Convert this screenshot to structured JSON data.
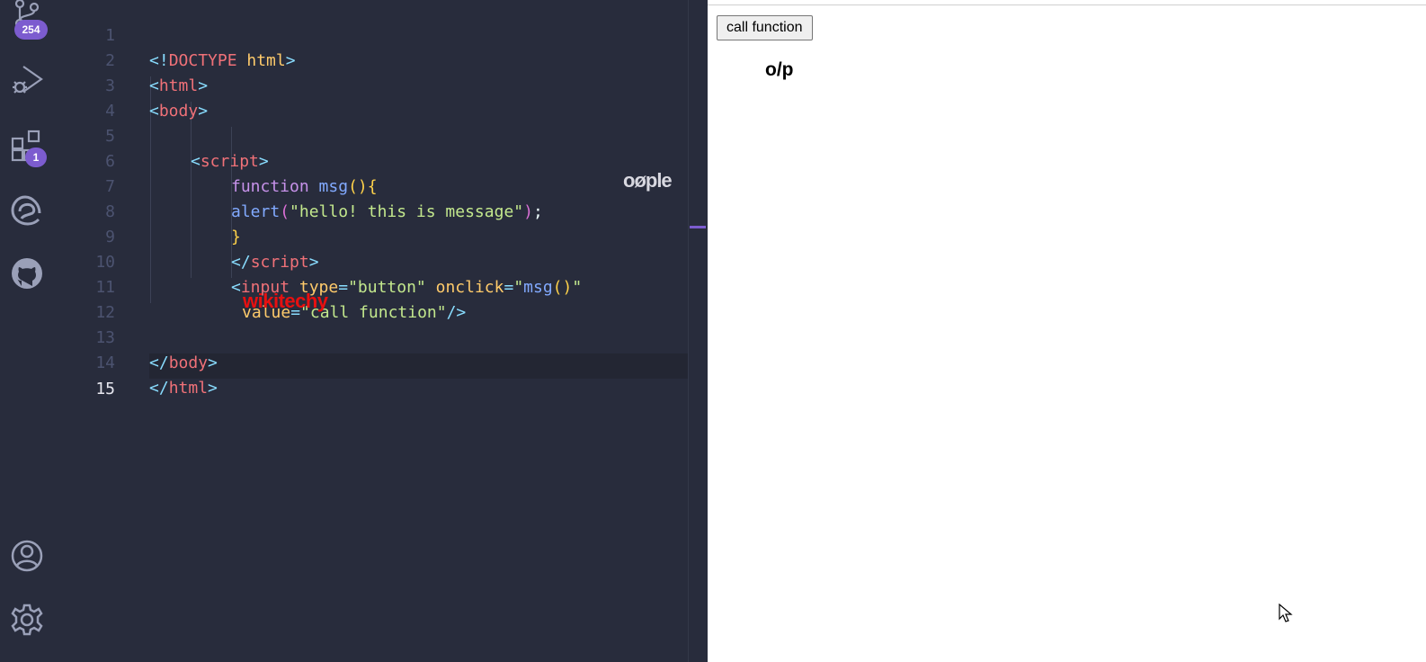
{
  "activity_bar": {
    "source_control_badge": "254",
    "extensions_badge": "1"
  },
  "editor": {
    "lines": [
      {
        "n": "1"
      },
      {
        "n": "2"
      },
      {
        "n": "3"
      },
      {
        "n": "4"
      },
      {
        "n": "5"
      },
      {
        "n": "6"
      },
      {
        "n": "7"
      },
      {
        "n": "8"
      },
      {
        "n": "9"
      },
      {
        "n": "10"
      },
      {
        "n": "11"
      },
      {
        "n": "12"
      },
      {
        "n": "13"
      },
      {
        "n": "14"
      },
      {
        "n": "15"
      }
    ],
    "code": {
      "l1_a": "<!",
      "l1_b": "DOCTYPE",
      "l1_c": " html",
      "l1_d": ">",
      "l2_a": "<",
      "l2_b": "html",
      "l2_c": ">",
      "l3_a": "<",
      "l3_b": "body",
      "l3_c": ">",
      "l5_a": "<",
      "l5_b": "script",
      "l5_c": ">",
      "l6_a": "function",
      "l6_b": " msg",
      "l6_c": "()",
      "l6_d": "{",
      "l7_a": "alert",
      "l7_b": "(",
      "l7_c": "\"hello! this is message\"",
      "l7_d": ")",
      "l7_e": ";",
      "l8_a": "}",
      "l9_a": "</",
      "l9_b": "script",
      "l9_c": ">",
      "l10_a": "<",
      "l10_b": "input",
      "l10_c": " type",
      "l10_d": "=",
      "l10_e": "\"button\"",
      "l10_f": " onclick",
      "l10_g": "=",
      "l10_h": "\"",
      "l10_i": "msg",
      "l10_j": "()",
      "l10_k": "\"",
      "l11_a": "value",
      "l11_b": "=",
      "l11_c": "\"call function\"",
      "l11_d": "/>",
      "l13_a": "</",
      "l13_b": "body",
      "l13_c": ">",
      "l14_a": "</",
      "l14_b": "html",
      "l14_c": ">"
    },
    "watermark_red": "wikitechy",
    "watermark_white": "oøple"
  },
  "preview": {
    "button_label": "call function",
    "output_label": "o/p"
  },
  "colors": {
    "background": "#282c3c",
    "accent": "#7c5ccf",
    "tag": "#f07178",
    "string": "#c3e88d",
    "keyword": "#c792ea",
    "function": "#82aaff"
  }
}
